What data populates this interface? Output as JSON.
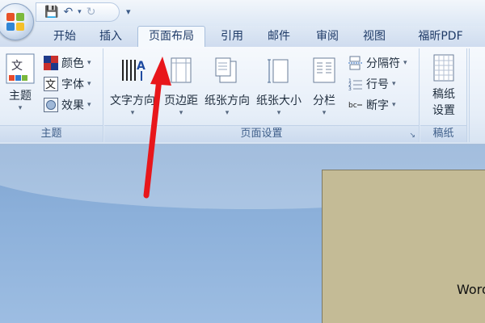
{
  "quick_access": {
    "save_icon": "save-icon",
    "undo_icon": "undo-icon",
    "redo_icon": "redo-icon",
    "customize_icon": "dropdown-icon"
  },
  "tabs": [
    {
      "label": "开始"
    },
    {
      "label": "插入"
    },
    {
      "label": "页面布局",
      "active": true
    },
    {
      "label": "引用"
    },
    {
      "label": "邮件"
    },
    {
      "label": "审阅"
    },
    {
      "label": "视图"
    },
    {
      "label": "福昕PDF"
    }
  ],
  "ribbon": {
    "theme_group": {
      "label": "主题",
      "theme_button": "主题",
      "colors": "颜色",
      "fonts": "字体",
      "effects": "效果"
    },
    "page_setup_group": {
      "label": "页面设置",
      "text_direction": "文字方向",
      "margins": "页边距",
      "orientation": "纸张方向",
      "size": "纸张大小",
      "columns": "分栏",
      "breaks": "分隔符",
      "line_numbers": "行号",
      "hyphenation": "断字"
    },
    "manuscript_group": {
      "label": "稿纸",
      "manuscript_settings_line1": "稿纸",
      "manuscript_settings_line2": "设置"
    }
  },
  "document": {
    "visible_text": "Word"
  },
  "colors": {
    "annotation_arrow": "#e8161b",
    "page_background": "#c4bb96",
    "ribbon_accent": "#1e3a67"
  }
}
